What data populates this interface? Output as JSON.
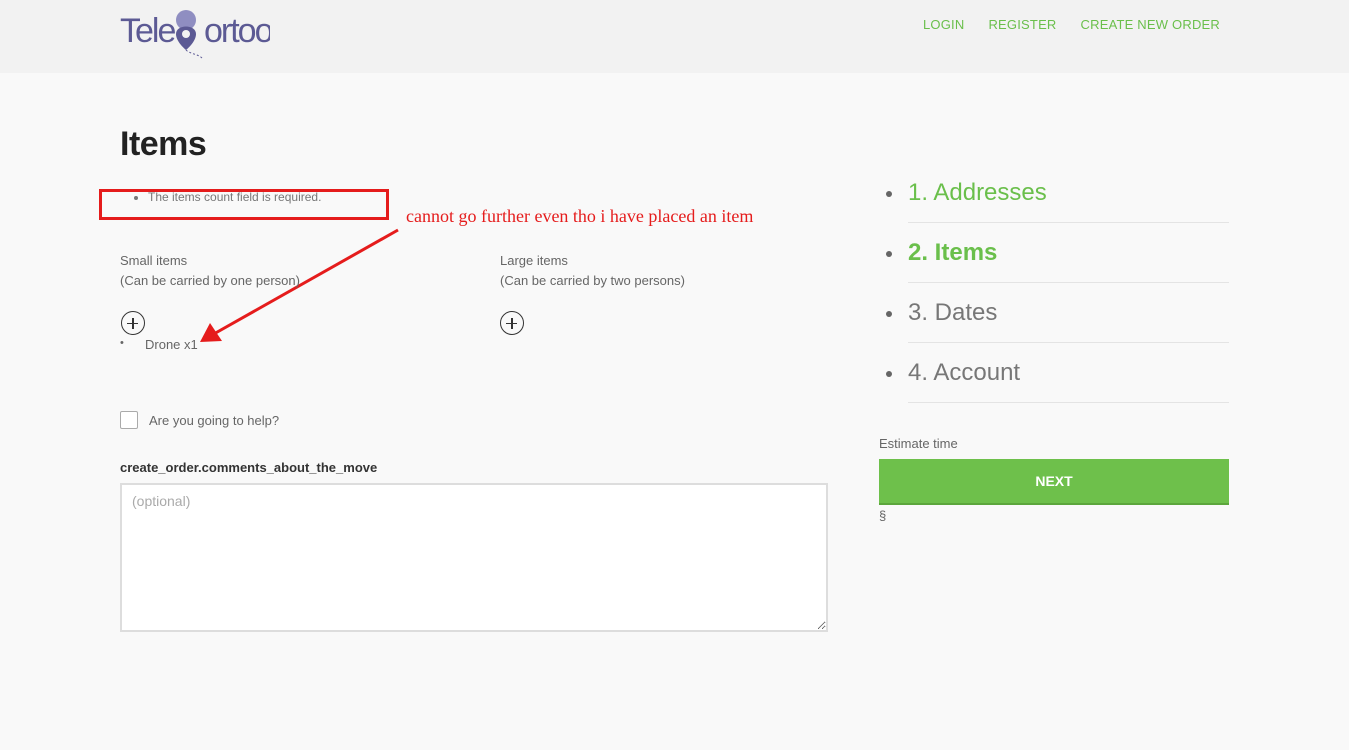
{
  "header": {
    "logo_text": "Teleportoo",
    "nav": [
      "LOGIN",
      "REGISTER",
      "CREATE NEW ORDER"
    ]
  },
  "main": {
    "title": "Items",
    "errors": [
      "The items count field is required."
    ],
    "small_items": {
      "label": "Small items",
      "hint": "(Can be carried by one person)"
    },
    "large_items": {
      "label": "Large items",
      "hint": "(Can be carried by two persons)"
    },
    "items_list": [
      "Drone x1"
    ],
    "help_label": "Are you going to help?",
    "comments_label": "create_order.comments_about_the_move",
    "comments_placeholder": "(optional)"
  },
  "annotation": {
    "text": "cannot go further even tho i have placed an item",
    "color": "#e51c1c"
  },
  "sidebar": {
    "steps": [
      {
        "label": "1. Addresses",
        "state": "done"
      },
      {
        "label": "2. Items",
        "state": "active"
      },
      {
        "label": "3. Dates",
        "state": "todo"
      },
      {
        "label": "4. Account",
        "state": "todo"
      }
    ],
    "estimate_label": "Estimate time",
    "next_label": "NEXT",
    "section_mark": "§"
  },
  "colors": {
    "accent": "#6ec04b",
    "logo": "#5c5a94"
  }
}
